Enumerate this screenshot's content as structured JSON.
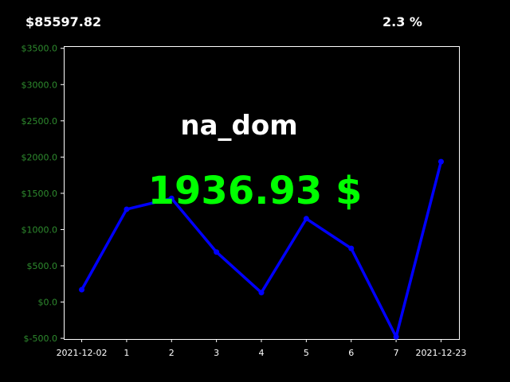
{
  "header": {
    "total_value": "$85597.82",
    "percent_change": "2.3 %"
  },
  "chart_data": {
    "type": "line",
    "title": "na_dom",
    "current_value_label": "1936.93 $",
    "x_tick_labels": [
      "2021-12-02",
      "1",
      "2",
      "3",
      "4",
      "5",
      "6",
      "7",
      "2021-12-23"
    ],
    "y_tick_labels": [
      "$-500.0",
      "$0.0",
      "$500.0",
      "$1000.0",
      "$1500.0",
      "$2000.0",
      "$2500.0",
      "$3000.0",
      "$3500.0"
    ],
    "y_ticks": [
      -500,
      0,
      500,
      1000,
      1500,
      2000,
      2500,
      3000,
      3500
    ],
    "ylim": [
      -510,
      3530
    ],
    "xlim": [
      -0.4,
      8.4
    ],
    "series": [
      {
        "x": [
          0,
          1,
          2,
          3,
          4,
          5,
          6,
          7,
          8
        ],
        "values": [
          170,
          1280,
          1430,
          690,
          130,
          1150,
          740,
          -480,
          1936.93
        ]
      }
    ],
    "colors": {
      "line": "#0000ff",
      "title": "#ffffff",
      "value_label": "#00ff00",
      "y_tick_labels": "#2e8b2e",
      "x_tick_labels": "#ffffff",
      "axes": "#ffffff",
      "background": "#000000"
    },
    "grid": false
  }
}
